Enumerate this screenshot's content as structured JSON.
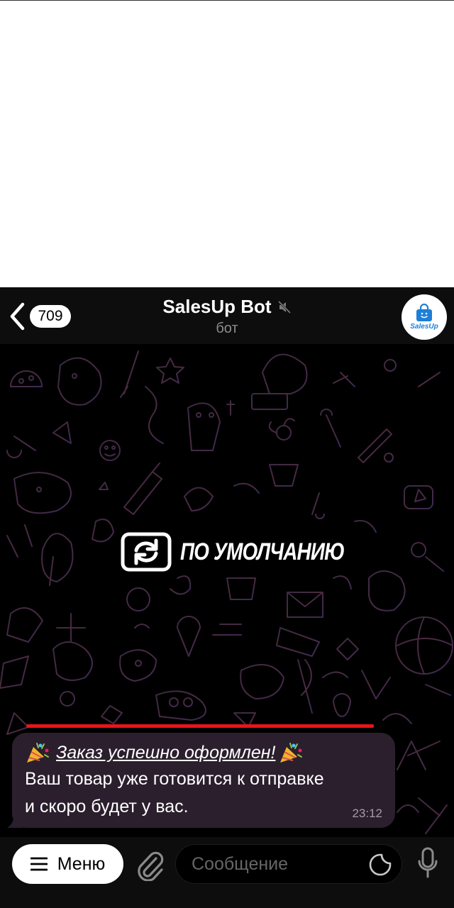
{
  "header": {
    "back_count": "709",
    "title": "SalesUp Bot",
    "subtitle": "бот",
    "avatar_text": "SalesUp"
  },
  "wallpaper": {
    "label": "ПО УМОЛЧАНИЮ"
  },
  "message": {
    "title": "Заказ успешно оформлен!",
    "line2": "Ваш товар уже готовится к отправке",
    "line3": "и скоро будет у вас.",
    "time": "23:12"
  },
  "input_bar": {
    "menu_label": "Меню",
    "placeholder": "Сообщение"
  },
  "colors": {
    "accent_red": "#e8141b",
    "bubble": "#2b1f2e",
    "brand_blue": "#1e7fd8"
  }
}
